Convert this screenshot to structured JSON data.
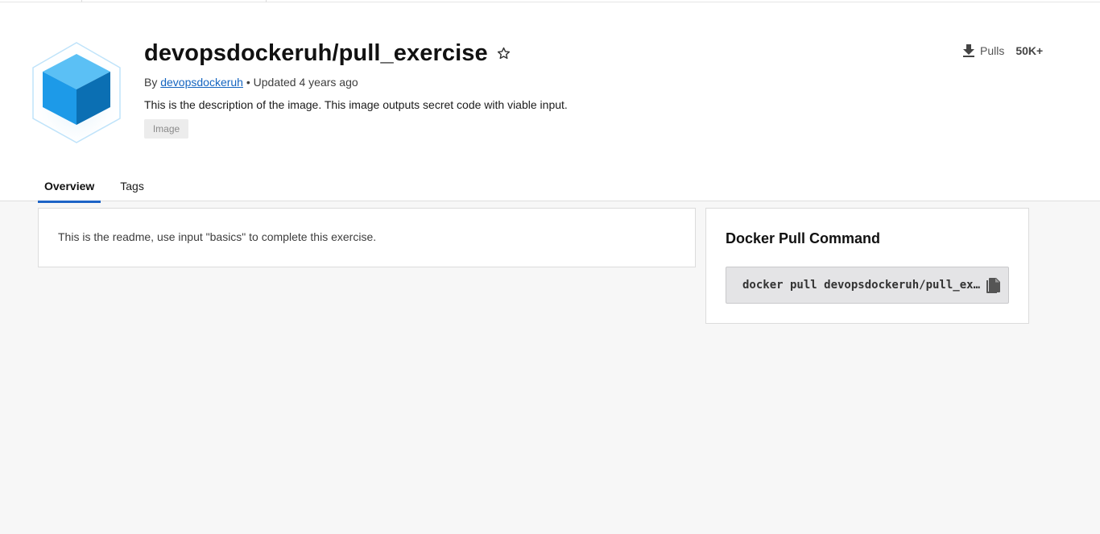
{
  "repo": {
    "title": "devopsdockeruh/pull_exercise",
    "by_prefix": "By ",
    "author": "devopsdockeruh",
    "updated": " • Updated 4 years ago",
    "description": "This is the description of the image. This image outputs secret code with viable input.",
    "badge": "Image"
  },
  "stats": {
    "pulls_label": "Pulls",
    "pulls_count": "50K+"
  },
  "tabs": [
    {
      "label": "Overview",
      "active": true
    },
    {
      "label": "Tags",
      "active": false
    }
  ],
  "readme": {
    "text": "This is the readme, use input \"basics\" to complete this exercise."
  },
  "pull_command": {
    "heading": "Docker Pull Command",
    "command": "docker pull devopsdockeruh/pull_exercise"
  },
  "icons": {
    "logo": "cube-icon",
    "favorite": "star-icon",
    "pulls": "download-icon",
    "copy": "copy-icon"
  },
  "colors": {
    "accent": "#1d63c6",
    "link": "#1565c0",
    "cube_light": "#5bc0f5",
    "cube_mid": "#1d9ae8",
    "cube_dark": "#0b6fb3"
  }
}
